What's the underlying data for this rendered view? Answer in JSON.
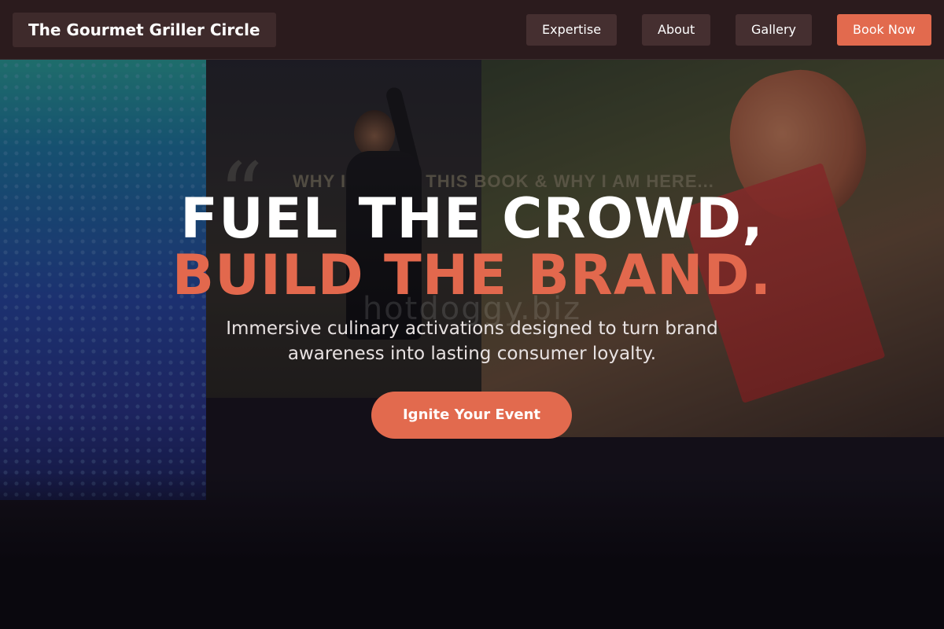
{
  "brand": {
    "name": "The Gourmet Griller Circle"
  },
  "nav": {
    "links": [
      {
        "label": "Expertise"
      },
      {
        "label": "About"
      },
      {
        "label": "Gallery"
      }
    ],
    "book_label": "Book Now"
  },
  "hero": {
    "headline_line1": "FUEL THE CROWD,",
    "headline_line2": "BUILD THE BRAND.",
    "subtitle": "Immersive culinary activations designed to turn brand awareness into lasting consumer loyalty.",
    "cta_label": "Ignite Your Event",
    "background_screen_text": "WHY I WROTE THIS BOOK & WHY I AM HERE...",
    "watermark": "hotdoggy.biz"
  },
  "colors": {
    "accent": "#e26a4e",
    "nav_bg": "#2c1c1e",
    "nav_button_bg": "#452f30"
  }
}
